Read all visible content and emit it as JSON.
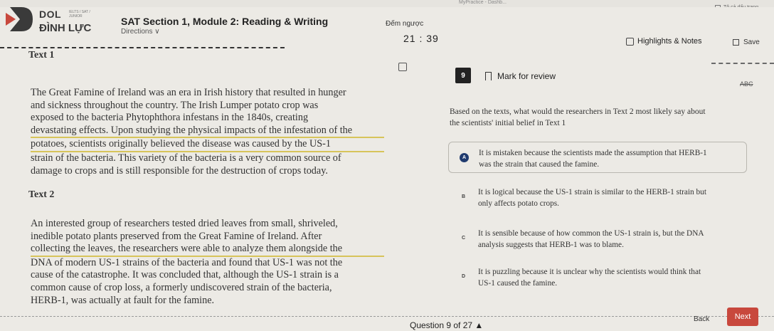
{
  "browser": {
    "tab_title": "MyPractice - Dashb...",
    "highlight_all": "Tô cả dấu trang"
  },
  "header": {
    "logo_line1": "DOL",
    "logo_tiny": "IELTS / SAT / JUNIOR",
    "logo_line2": "ĐÌNH LỰC",
    "section_title": "SAT Section 1, Module 2: Reading & Writing",
    "directions_label": "Directions",
    "timer_label": "Đếm ngược",
    "timer_value": "21 : 39",
    "highlights_label": "Highlights & Notes",
    "save_label": "Save"
  },
  "passage": {
    "text1_heading": "Text 1",
    "text1_lines": [
      "The Great Famine of Ireland was an era in Irish history that resulted in hunger",
      "and sickness throughout the country. The Irish Lumper potato crop was",
      "exposed to the bacteria Phytophthora infestans in the 1840s, creating",
      "devastating effects. Upon studying the physical impacts of the infestation of the",
      "potatoes, scientists originally believed the disease was caused by the US-1",
      "strain of the bacteria. This variety of the bacteria is a very common source of",
      "damage to crops and is still responsible for the destruction of crops today."
    ],
    "text2_heading": "Text 2",
    "text2_lines": [
      "An interested group of researchers tested dried leaves from small, shriveled,",
      "inedible potato plants preserved from the Great Famine of Ireland. After",
      "collecting the leaves, the researchers were able to analyze them alongside the",
      "DNA of modern US-1 strains of the bacteria and found that US-1 was not the",
      "cause of the catastrophe. It was concluded that, although the US-1 strain is a",
      "common cause of crop loss, a formerly undiscovered strain of the bacteria,",
      "HERB-1, was actually at fault for the famine."
    ]
  },
  "question": {
    "number": "9",
    "mark_review_label": "Mark for review",
    "abc_label": "ABC",
    "stem_lines": [
      "Based on the texts, what would the researchers in Text 2 most likely say about",
      "the scientists' initial belief in Text 1"
    ],
    "choices": [
      {
        "letter": "A",
        "line1": "It is mistaken because the scientists made the assumption that HERB-1",
        "line2": "was the strain that caused the famine.",
        "selected": true
      },
      {
        "letter": "B",
        "line1": "It is logical because the US-1 strain is similar to the HERB-1 strain but",
        "line2": "only affects potato crops.",
        "selected": false
      },
      {
        "letter": "C",
        "line1": "It is sensible because of how common the US-1 strain is, but the DNA",
        "line2": "analysis suggests that HERB-1 was to blame.",
        "selected": false
      },
      {
        "letter": "D",
        "line1": "It is puzzling because it is unclear why the scientists would think that",
        "line2": "US-1 caused the famine.",
        "selected": false
      }
    ]
  },
  "footer": {
    "question_nav": "Question 9 of 27",
    "back_label": "Back",
    "next_label": "Next"
  },
  "colors": {
    "accent_next": "#c8483d",
    "selected_letter": "#1f3a6e",
    "highlight_underline": "#d7c45a"
  }
}
